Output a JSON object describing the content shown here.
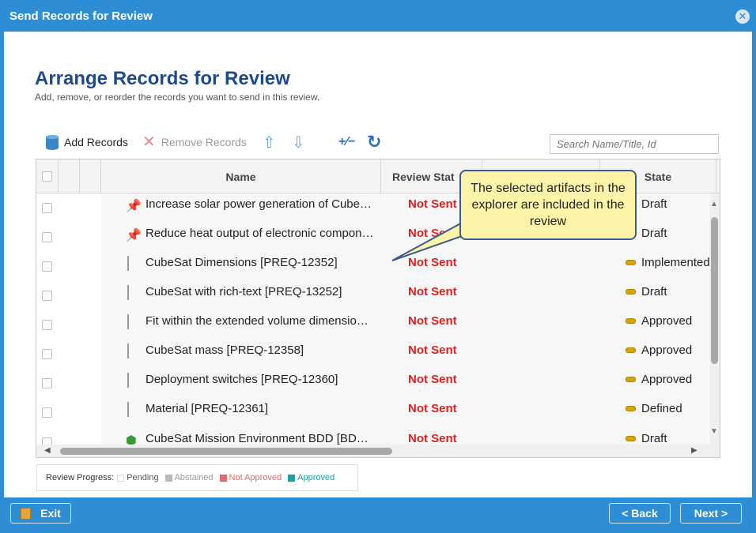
{
  "window": {
    "title": "Send Records for Review",
    "close_glyph": "✕"
  },
  "page": {
    "heading": "Arrange Records for Review",
    "subheading": "Add, remove, or reorder the records you want to send in this review."
  },
  "toolbar": {
    "add_label": "Add Records",
    "remove_label": "Remove Records",
    "move_up_glyph": "⇧",
    "move_down_glyph": "⇩",
    "toggle_glyph": "+⁄−",
    "refresh_glyph": "↻"
  },
  "search": {
    "placeholder": "Search Name/Title, Id"
  },
  "grid": {
    "columns": {
      "name": "Name",
      "review_status": "Review Stat",
      "state": "State"
    },
    "rows": [
      {
        "icon": "pin-icon",
        "name": "Increase solar power generation of Cube…",
        "status": "Not Sent",
        "state": "Draft"
      },
      {
        "icon": "pin-icon",
        "name": "Reduce heat output of electronic compon…",
        "status": "Not Sent",
        "state": "Draft"
      },
      {
        "icon": "document-icon",
        "name": "CubeSat Dimensions [PREQ-12352]",
        "status": "Not Sent",
        "state": "Implemented"
      },
      {
        "icon": "document-icon",
        "name": "CubeSat with rich-text [PREQ-13252]",
        "status": "Not Sent",
        "state": "Draft"
      },
      {
        "icon": "document-icon",
        "name": "Fit within the extended volume dimension…",
        "status": "Not Sent",
        "state": "Approved"
      },
      {
        "icon": "document-icon",
        "name": "CubeSat mass [PREQ-12358]",
        "status": "Not Sent",
        "state": "Approved"
      },
      {
        "icon": "document-icon",
        "name": "Deployment switches [PREQ-12360]",
        "status": "Not Sent",
        "state": "Approved"
      },
      {
        "icon": "document-icon",
        "name": "Material [PREQ-12361]",
        "status": "Not Sent",
        "state": "Defined"
      },
      {
        "icon": "bdd-icon",
        "name": "CubeSat Mission Environment BDD [BDD…",
        "status": "Not Sent",
        "state": "Draft"
      }
    ]
  },
  "callout": {
    "text": "The selected artifacts in the explorer are included in the review"
  },
  "legend": {
    "label": "Review Progress:",
    "items": [
      {
        "name": "Pending",
        "color": "#ffffff"
      },
      {
        "name": "Abstained",
        "color": "#b9b9b9"
      },
      {
        "name": "Not Approved",
        "color": "#e46a6a"
      },
      {
        "name": "Approved",
        "color": "#1aa3a3"
      }
    ]
  },
  "footer": {
    "exit_label": "Exit",
    "back_label": "< Back",
    "next_label": "Next >"
  },
  "colors": {
    "accent": "#2d8ed6",
    "heading": "#1f4a8a",
    "not_sent": "#e02020",
    "state_pill": "#d8a500"
  }
}
